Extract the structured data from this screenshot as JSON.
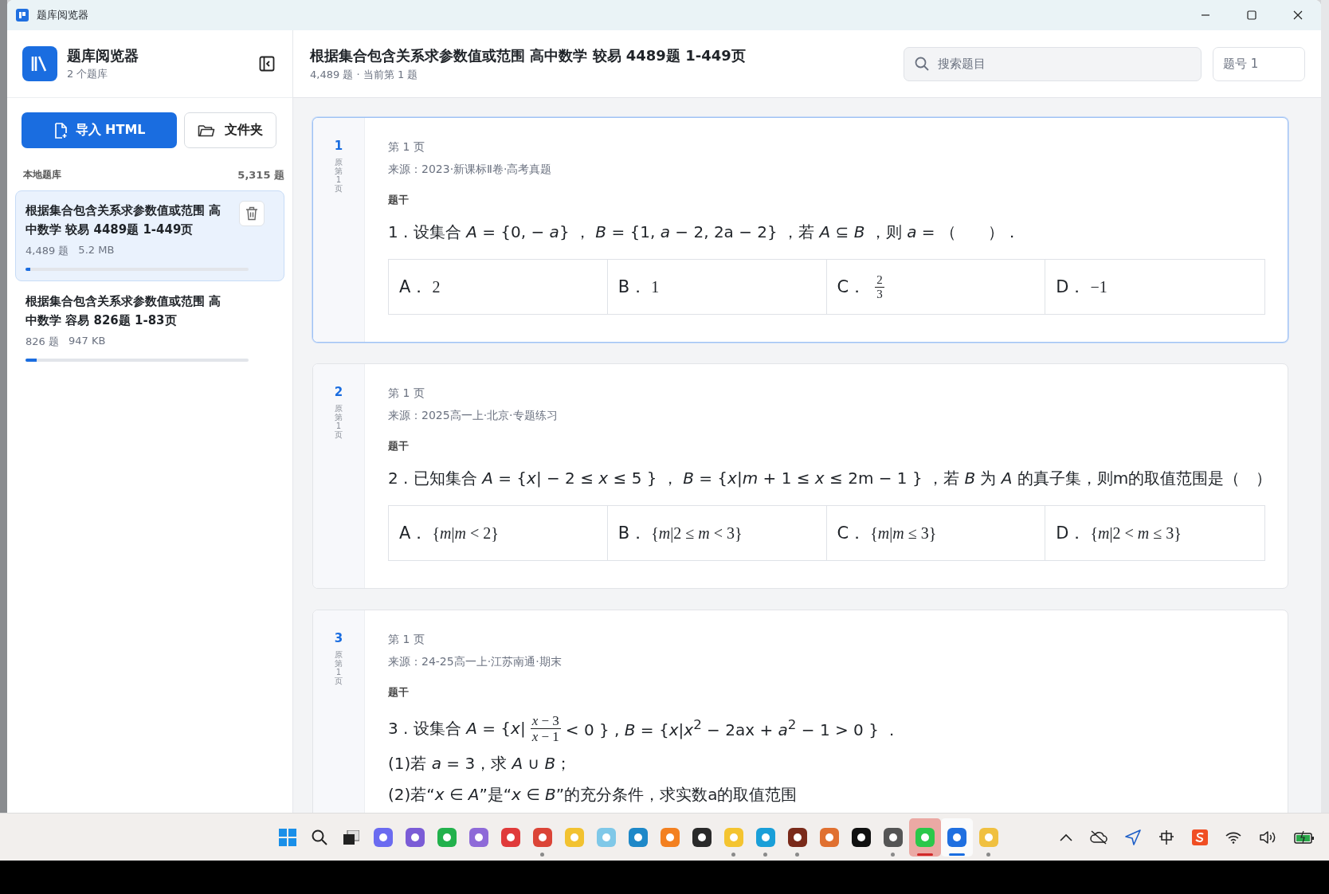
{
  "window": {
    "title": "题库阅览器"
  },
  "sidebar": {
    "app_name": "题库阅览器",
    "subtitle": "2 个题库",
    "import_button": "导入 HTML",
    "folder_button": "文件夹",
    "section_label": "本地题库",
    "section_count": "5,315 题",
    "items": [
      {
        "title": "根据集合包含关系求参数值或范围 高中数学 较易 4489题 1-449页",
        "count": "4,489 题",
        "size": "5.2 MB",
        "level": 0.02,
        "selected": true
      },
      {
        "title": "根据集合包含关系求参数值或范围 高中数学 容易 826题 1-83页",
        "count": "826 题",
        "size": "947 KB",
        "level": 0.05,
        "selected": false
      }
    ]
  },
  "header": {
    "title": "根据集合包含关系求参数值或范围 高中数学 较易 4489题 1-449页",
    "subtitle": "4,489 题 · 当前第 1 题",
    "search": {
      "placeholder": "搜索题目"
    },
    "question_number": {
      "placeholder": "题号 1"
    }
  },
  "questions": [
    {
      "number": "1",
      "origin": "原第1页",
      "selected": true,
      "page": "第 1 页",
      "source": "来源：2023·新课标Ⅱ卷·高考真题",
      "section": "题干",
      "stem": [
        {
          "kind": "text",
          "text": "1 . 设集合 *A* = {0, − *a*} ， *B* = {1, *a* − 2, 2a − 2} ，若 *A* ⊆ *B* ，则 *a* = （　　）．"
        }
      ],
      "options": [
        {
          "label": "A．",
          "kind": "text",
          "text": "2"
        },
        {
          "label": "B．",
          "kind": "text",
          "text": "1"
        },
        {
          "label": "C．",
          "kind": "fraction",
          "numerator": "2",
          "denominator": "3"
        },
        {
          "label": "D．",
          "kind": "text",
          "text": "−1"
        }
      ]
    },
    {
      "number": "2",
      "origin": "原第1页",
      "selected": false,
      "page": "第 1 页",
      "source": "来源：2025高一上·北京·专题练习",
      "section": "题干",
      "stem": [
        {
          "kind": "text",
          "text": "2 . 已知集合 *A* = {*x*| − 2 ≤ *x* ≤ 5 } ， *B* = {*x*|*m* + 1 ≤ *x* ≤ 2m − 1 } ，若 *B* 为 *A* 的真子集，则m的取值范围是（　）"
        }
      ],
      "options": [
        {
          "label": "A．",
          "kind": "text",
          "text": "{*m*|*m* < 2}"
        },
        {
          "label": "B．",
          "kind": "text",
          "text": "{*m*|2 ≤ *m* < 3}"
        },
        {
          "label": "C．",
          "kind": "text",
          "text": "{*m*|*m* ≤ 3}"
        },
        {
          "label": "D．",
          "kind": "text",
          "text": "{*m*|2 < *m* ≤ 3}"
        }
      ]
    },
    {
      "number": "3",
      "origin": "原第1页",
      "selected": false,
      "page": "第 1 页",
      "source": "来源：24-25高一上·江苏南通·期末",
      "section": "题干",
      "stem": [
        {
          "kind": "text",
          "text": "3 . 设集合 *A* = {*x*|"
        },
        {
          "kind": "fraction",
          "numerator": "*x* − 3",
          "denominator": "*x* − 1"
        },
        {
          "kind": "text",
          "text": "< 0 } , *B* = {*x*|*x*$^{2}$ − 2ax + *a*$^{2}$ − 1 > 0 } ．"
        }
      ],
      "lines": [
        "(1)若 *a* = 3，求 *A* ∪ *B*；",
        "(2)若“*x* ∈ *A*”是“*x* ∈ *B*”的充分条件，求实数a的取值范围"
      ]
    }
  ],
  "taskbar": {
    "items": [
      {
        "kind": "start",
        "running": false,
        "selected": false,
        "flagged": false
      },
      {
        "kind": "search",
        "running": false,
        "selected": false,
        "flagged": false
      },
      {
        "kind": "taskview",
        "running": false,
        "selected": false,
        "flagged": false
      },
      {
        "kind": "app",
        "color": "#6b6bf0",
        "running": false,
        "selected": false,
        "flagged": false
      },
      {
        "kind": "app",
        "color": "#7b5cd6",
        "running": false,
        "selected": false,
        "flagged": false
      },
      {
        "kind": "app",
        "color": "#22b14c",
        "running": false,
        "selected": false,
        "flagged": false
      },
      {
        "kind": "app",
        "color": "#8e6ad8",
        "running": false,
        "selected": false,
        "flagged": false
      },
      {
        "kind": "app",
        "color": "#e03a3a",
        "running": false,
        "selected": false,
        "flagged": false
      },
      {
        "kind": "app",
        "color": "#db4437",
        "running": true,
        "selected": false,
        "flagged": false
      },
      {
        "kind": "app",
        "color": "#f2c230",
        "running": false,
        "selected": false,
        "flagged": false
      },
      {
        "kind": "app",
        "color": "#7fc8e8",
        "running": false,
        "selected": false,
        "flagged": false
      },
      {
        "kind": "app",
        "color": "#1e88c8",
        "running": false,
        "selected": false,
        "flagged": false
      },
      {
        "kind": "app",
        "color": "#f38020",
        "running": false,
        "selected": false,
        "flagged": false
      },
      {
        "kind": "app",
        "color": "#2a2a2a",
        "running": false,
        "selected": false,
        "flagged": false
      },
      {
        "kind": "app",
        "color": "#f4c430",
        "running": true,
        "selected": false,
        "flagged": false
      },
      {
        "kind": "app",
        "color": "#1a9fd8",
        "running": true,
        "selected": false,
        "flagged": false
      },
      {
        "kind": "app",
        "color": "#7a2a1a",
        "running": true,
        "selected": false,
        "flagged": false
      },
      {
        "kind": "app",
        "color": "#e07030",
        "running": false,
        "selected": false,
        "flagged": false
      },
      {
        "kind": "app",
        "color": "#111111",
        "running": false,
        "selected": false,
        "flagged": false
      },
      {
        "kind": "app",
        "color": "#555555",
        "running": true,
        "selected": false,
        "flagged": false
      },
      {
        "kind": "app",
        "color": "#2bc84a",
        "running": true,
        "selected": false,
        "flagged": true
      },
      {
        "kind": "app",
        "color": "#1f6fe0",
        "running": true,
        "selected": true,
        "flagged": false
      },
      {
        "kind": "app",
        "color": "#f0c040",
        "running": true,
        "selected": false,
        "flagged": false
      }
    ],
    "tray": [
      {
        "kind": "chevron"
      },
      {
        "kind": "cloud"
      },
      {
        "kind": "send"
      },
      {
        "kind": "ime"
      },
      {
        "kind": "sogou"
      },
      {
        "kind": "wifi"
      },
      {
        "kind": "volume"
      },
      {
        "kind": "battery"
      }
    ]
  }
}
